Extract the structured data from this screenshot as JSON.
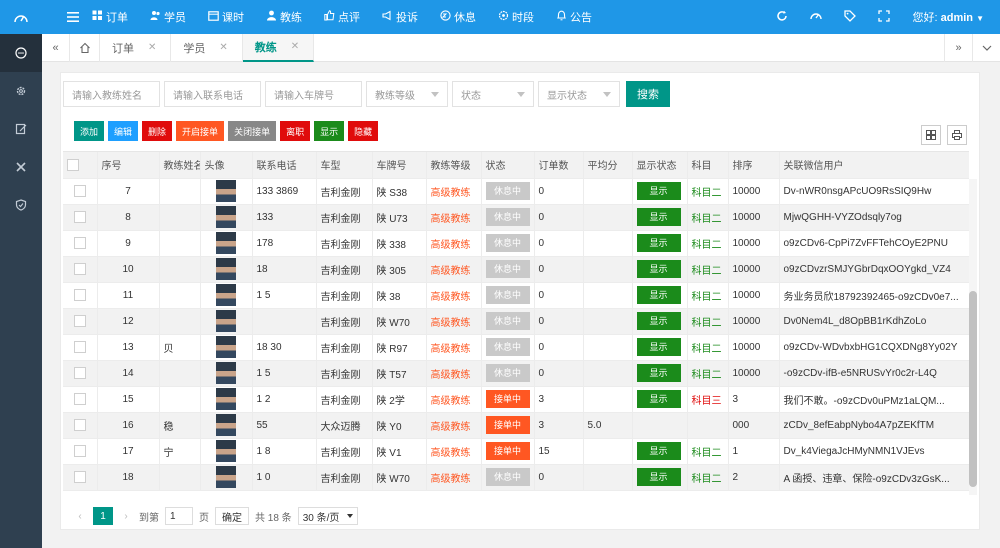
{
  "topbar": {
    "nav": [
      {
        "label": "订单",
        "icon": "grid-icon"
      },
      {
        "label": "学员",
        "icon": "users-icon"
      },
      {
        "label": "课时",
        "icon": "calendar-icon"
      },
      {
        "label": "教练",
        "icon": "person-icon"
      },
      {
        "label": "点评",
        "icon": "thumbs-up-icon"
      },
      {
        "label": "投诉",
        "icon": "megaphone-icon"
      },
      {
        "label": "休息",
        "icon": "rest-icon"
      },
      {
        "label": "时段",
        "icon": "clock-icon"
      },
      {
        "label": "公告",
        "icon": "bell-icon"
      }
    ],
    "greeting": "您好:",
    "user": "admin"
  },
  "tabs": [
    {
      "label": "订单",
      "active": false
    },
    {
      "label": "学员",
      "active": false
    },
    {
      "label": "教练",
      "active": true
    }
  ],
  "search": {
    "name_placeholder": "请输入教练姓名",
    "phone_placeholder": "请输入联系电话",
    "plate_placeholder": "请输入车牌号",
    "level_select": "教练等级",
    "state_select": "状态",
    "display_select": "显示状态",
    "search_button": "搜索"
  },
  "toolbar": {
    "add": "添加",
    "edit": "编辑",
    "delete": "删除",
    "open": "开启接单",
    "close": "关闭接单",
    "resign": "离职",
    "show": "显示",
    "hide": "隐藏"
  },
  "table": {
    "headers": [
      "序号",
      "教练姓名",
      "头像",
      "联系电话",
      "车型",
      "车牌号",
      "教练等级",
      "状态",
      "订单数",
      "平均分",
      "显示状态",
      "科目",
      "排序",
      "关联微信用户"
    ],
    "rows": [
      {
        "no": "7",
        "name": "",
        "phone": "133       3869",
        "car": "吉利金刚",
        "plate": "陕      S38",
        "level": "高级教练",
        "state": "休息中",
        "state_type": "rest",
        "orders": "0",
        "avg": "",
        "display": "显示",
        "subject": "科目二",
        "sort": "10000",
        "wechat": "Dv-nWR0nsgAPcUO9RsSIQ9Hw"
      },
      {
        "no": "8",
        "name": "",
        "phone": "133",
        "car": "吉利金刚",
        "plate": "陕      U73",
        "level": "高级教练",
        "state": "休息中",
        "state_type": "rest",
        "orders": "0",
        "avg": "",
        "display": "显示",
        "subject": "科目二",
        "sort": "10000",
        "wechat": "MjwQGHH-VYZOdsqly7og"
      },
      {
        "no": "9",
        "name": "",
        "phone": "178",
        "car": "吉利金刚",
        "plate": "陕      338",
        "level": "高级教练",
        "state": "休息中",
        "state_type": "rest",
        "orders": "0",
        "avg": "",
        "display": "显示",
        "subject": "科目二",
        "sort": "10000",
        "wechat": "o9zCDv6-CpPi7ZvFFTehCOyE2PNU"
      },
      {
        "no": "10",
        "name": "",
        "phone": "18",
        "car": "吉利金刚",
        "plate": "陕      305",
        "level": "高级教练",
        "state": "休息中",
        "state_type": "rest",
        "orders": "0",
        "avg": "",
        "display": "显示",
        "subject": "科目二",
        "sort": "10000",
        "wechat": "o9zCDvzrSMJYGbrDqxOOYgkd_VZ4"
      },
      {
        "no": "11",
        "name": "",
        "phone": "1        5",
        "car": "吉利金刚",
        "plate": "陕      38",
        "level": "高级教练",
        "state": "休息中",
        "state_type": "rest",
        "orders": "0",
        "avg": "",
        "display": "显示",
        "subject": "科目二",
        "sort": "10000",
        "wechat": "务业务员欣18792392465-o9zCDv0e7..."
      },
      {
        "no": "12",
        "name": "",
        "phone": "",
        "car": "吉利金刚",
        "plate": "陕      W70",
        "level": "高级教练",
        "state": "休息中",
        "state_type": "rest",
        "orders": "0",
        "avg": "",
        "display": "显示",
        "subject": "科目二",
        "sort": "10000",
        "wechat": "Dv0Nem4L_d8OpBB1rKdhZoLo"
      },
      {
        "no": "13",
        "name": "贝",
        "phone": "18        30",
        "car": "吉利金刚",
        "plate": "陕      R97",
        "level": "高级教练",
        "state": "休息中",
        "state_type": "rest",
        "orders": "0",
        "avg": "",
        "display": "显示",
        "subject": "科目二",
        "sort": "10000",
        "wechat": "o9zCDv-WDvbxbHG1CQXDNg8Yy02Y"
      },
      {
        "no": "14",
        "name": "",
        "phone": "1         5",
        "car": "吉利金刚",
        "plate": "陕      T57",
        "level": "高级教练",
        "state": "休息中",
        "state_type": "rest",
        "orders": "0",
        "avg": "",
        "display": "显示",
        "subject": "科目二",
        "sort": "10000",
        "wechat": "-o9zCDv-ifB-e5NRUSvYr0c2r-L4Q"
      },
      {
        "no": "15",
        "name": "",
        "phone": "1        2",
        "car": "吉利金刚",
        "plate": "陕      2学",
        "level": "高级教练",
        "state": "接单中",
        "state_type": "take",
        "orders": "3",
        "avg": "",
        "display": "显示",
        "subject": "科目三",
        "sort": "3",
        "wechat": "我们不敢。-o9zCDv0uPMz1aLQM..."
      },
      {
        "no": "16",
        "name": "稳",
        "phone": "        55",
        "car": "大众迈腾",
        "plate": "陕      Y0",
        "level": "高级教练",
        "state": "接单中",
        "state_type": "take",
        "orders": "3",
        "avg": "5.0",
        "display": "",
        "subject": "",
        "sort": "000",
        "wechat": "zCDv_8efEabpNybo4A7pZEKfTM"
      },
      {
        "no": "17",
        "name": "宁",
        "phone": "1        8",
        "car": "吉利金刚",
        "plate": "陕      V1",
        "level": "高级教练",
        "state": "接单中",
        "state_type": "take",
        "orders": "15",
        "avg": "",
        "display": "显示",
        "subject": "科目二",
        "sort": "1",
        "wechat": "Dv_k4ViegaJcHMyNMN1VJEvs"
      },
      {
        "no": "18",
        "name": "",
        "phone": "1         0",
        "car": "吉利金刚",
        "plate": "陕      W70",
        "level": "高级教练",
        "state": "休息中",
        "state_type": "rest",
        "orders": "0",
        "avg": "",
        "display": "显示",
        "subject": "科目二",
        "sort": "2",
        "wechat": "A        函授、违章、保险-o9zCDv3zGsK..."
      }
    ]
  },
  "pager": {
    "current": "1",
    "jump_prefix": "到第",
    "jump_value": "1",
    "jump_suffix": "页",
    "confirm": "确定",
    "total": "共 18 条",
    "page_size": "30 条/页"
  },
  "colors": {
    "topbar": "#1f97e7",
    "sidebar": "#2f4050",
    "primary": "#009688",
    "accent": "#ff5722",
    "danger": "#e00c0c",
    "success": "#1b8b1b"
  }
}
